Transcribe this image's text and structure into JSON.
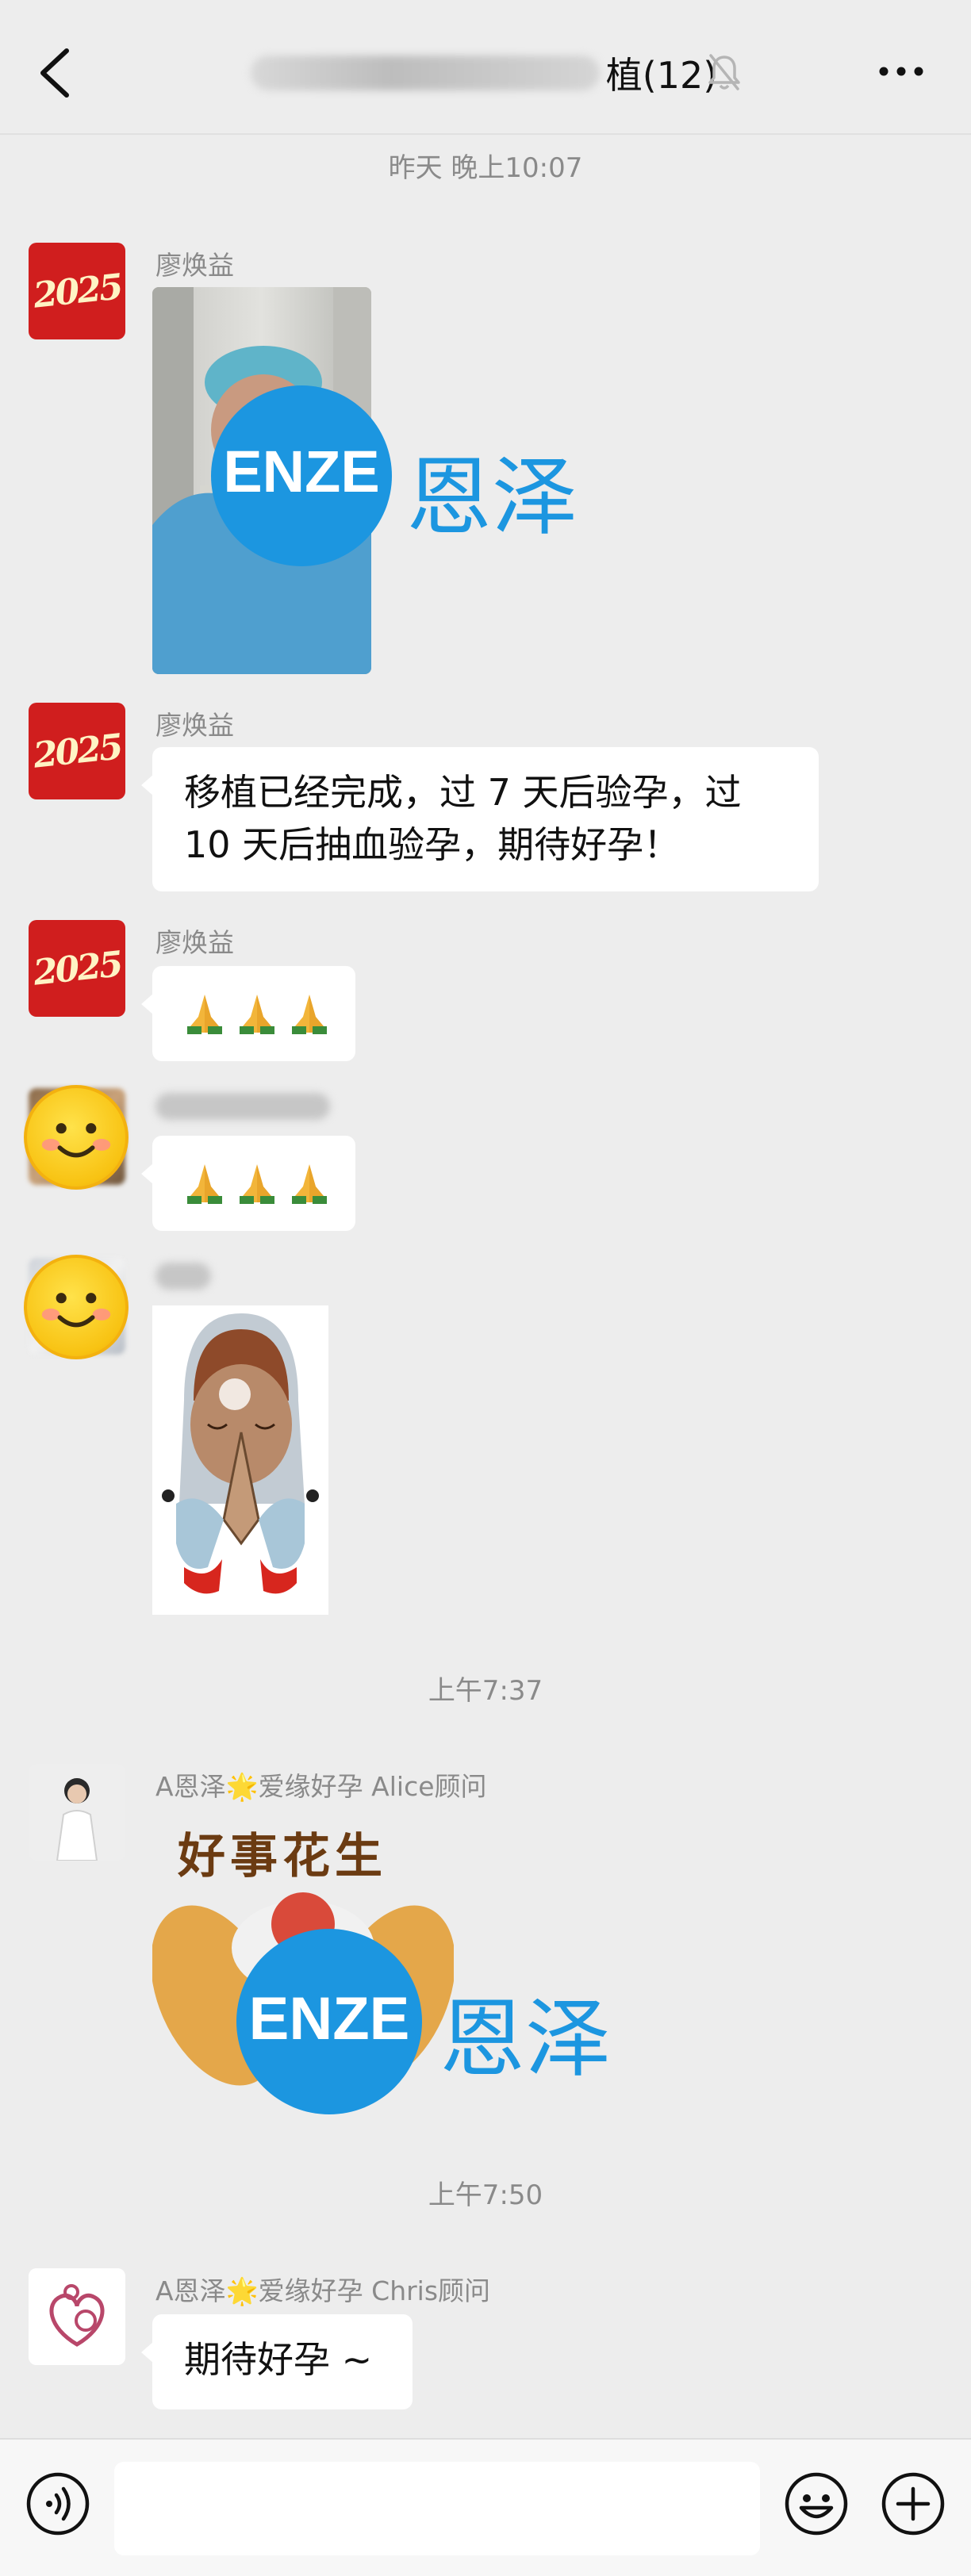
{
  "header": {
    "title_suffix": "植(12)",
    "back_icon": "chevron-left-icon",
    "mute_icon": "bell-muted-icon",
    "more_icon": "more-dots-icon"
  },
  "messages": {
    "time_1": "昨天 晚上10:07",
    "sender_liao": "廖焕益",
    "avatar_2025": "2025",
    "watermark_enze": "ENZE",
    "watermark_cn": "恩泽",
    "text_1_line1": "移植已经完成，过 7 天后验孕，过",
    "text_1_line2": "10 天后抽血验孕，期待好孕！",
    "pray_emoji": "🙏🙏🙏",
    "sticker_text": "好事花生",
    "time_2": "上午7:37",
    "sender_alice": "A恩泽🌟爱缘好孕 Alice顾问",
    "time_3": "上午7:50",
    "sender_chris": "A恩泽🌟爱缘好孕 Chris顾问",
    "text_2": "期待好孕 ~"
  },
  "input": {
    "voice_icon": "voice-icon",
    "emoji_icon": "emoji-icon",
    "plus_icon": "plus-icon",
    "placeholder": ""
  }
}
